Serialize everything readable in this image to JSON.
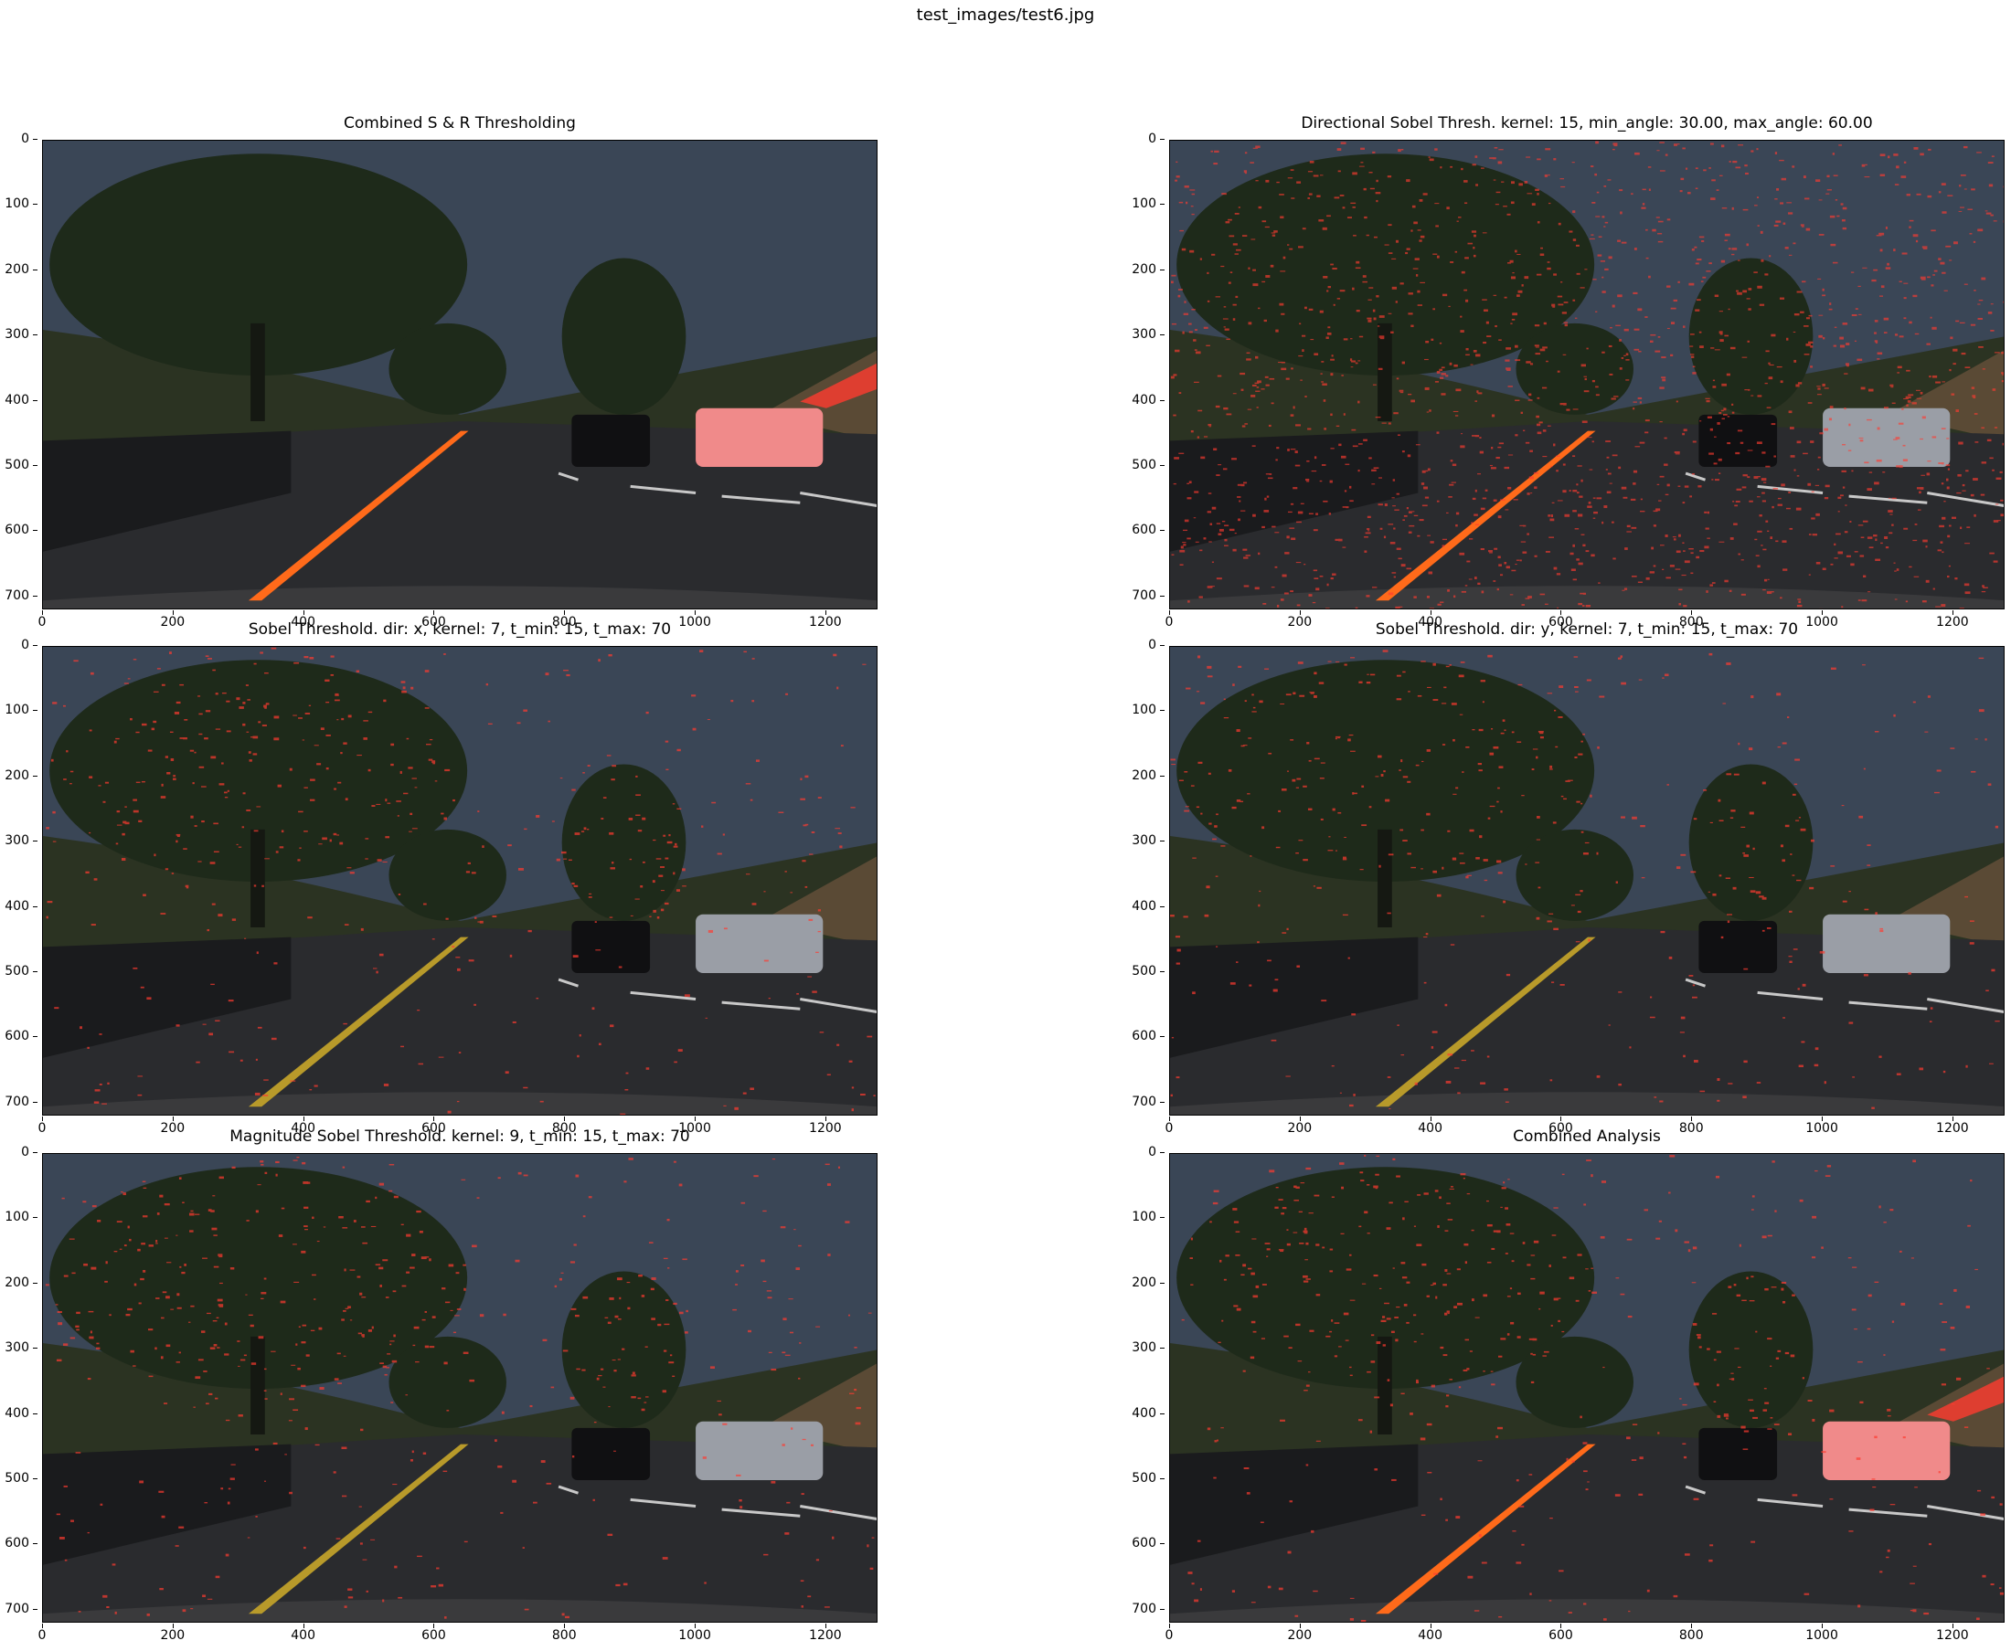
{
  "figure": {
    "title": "test_images/test6.jpg"
  },
  "panels": [
    {
      "id": "combined-sr",
      "title": "Combined S & R Thresholding",
      "overlay": "sr"
    },
    {
      "id": "directional-sobel",
      "title": "Directional Sobel Thresh. kernel: 15, min_angle: 30.00, max_angle: 60.00",
      "overlay": "noise"
    },
    {
      "id": "sobel-x",
      "title": "Sobel Threshold. dir: x, kernel: 7, t_min: 15, t_max: 70",
      "overlay": "edges"
    },
    {
      "id": "sobel-y",
      "title": "Sobel Threshold. dir: y, kernel: 7, t_min: 15, t_max: 70",
      "overlay": "edges"
    },
    {
      "id": "magnitude-sobel",
      "title": "Magnitude Sobel Threshold. kernel: 9, t_min: 15, t_max: 70",
      "overlay": "edges"
    },
    {
      "id": "combined-analysis",
      "title": "Combined Analysis",
      "overlay": "edges-sr"
    }
  ],
  "axes": {
    "x_ticks": [
      "0",
      "200",
      "400",
      "600",
      "800",
      "1000",
      "1200"
    ],
    "y_ticks": [
      "0",
      "100",
      "200",
      "300",
      "400",
      "500",
      "600",
      "700"
    ],
    "x_range": [
      0,
      1280
    ],
    "y_range": [
      0,
      720
    ]
  },
  "colors": {
    "sky": "#3a4656",
    "road": "#2a2b2e",
    "overlay_red": "#ff3b30",
    "lane_orange": "#ff6a1a",
    "tree_dark": "#1e2a1a"
  }
}
